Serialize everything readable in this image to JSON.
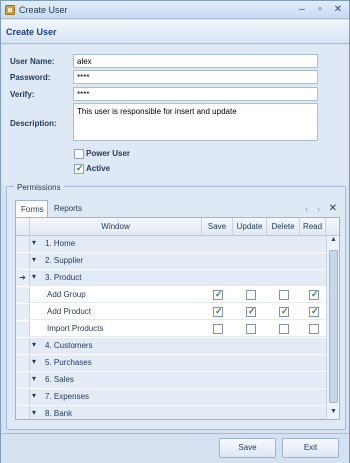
{
  "window": {
    "title": "Create User"
  },
  "header": {
    "title": "Create User"
  },
  "form": {
    "username_label": "User Name:",
    "username_value": "alex",
    "password_label": "Password:",
    "password_value": "****",
    "verify_label": "Verify:",
    "verify_value": "****",
    "description_label": "Description:",
    "description_value": "This user is responsible for insert and update",
    "power_user_label": "Power User",
    "power_user_checked": false,
    "active_label": "Active",
    "active_checked": true
  },
  "permissions": {
    "caption": "Permissions",
    "tabs": [
      "Forms",
      "Reports"
    ],
    "active_tab": "Forms",
    "columns": [
      "Window",
      "Save",
      "Update",
      "Delete",
      "Read"
    ],
    "rows": [
      {
        "type": "group",
        "label": "1. Home"
      },
      {
        "type": "group",
        "label": "2. Supplier"
      },
      {
        "type": "group",
        "label": "3. Product",
        "current": true
      },
      {
        "type": "child",
        "label": "Add Group",
        "save": true,
        "update": false,
        "delete": false,
        "read": true
      },
      {
        "type": "child",
        "label": "Add Product",
        "save": true,
        "update": true,
        "delete": true,
        "read": true
      },
      {
        "type": "child",
        "label": "Import Products",
        "save": false,
        "update": false,
        "delete": false,
        "read": false
      },
      {
        "type": "group",
        "label": "4. Customers"
      },
      {
        "type": "group",
        "label": "5. Purchases"
      },
      {
        "type": "group",
        "label": "6. Sales"
      },
      {
        "type": "group",
        "label": "7. Expenses"
      },
      {
        "type": "group",
        "label": "8. Bank"
      }
    ]
  },
  "footer": {
    "save_label": "Save",
    "exit_label": "Exit"
  }
}
